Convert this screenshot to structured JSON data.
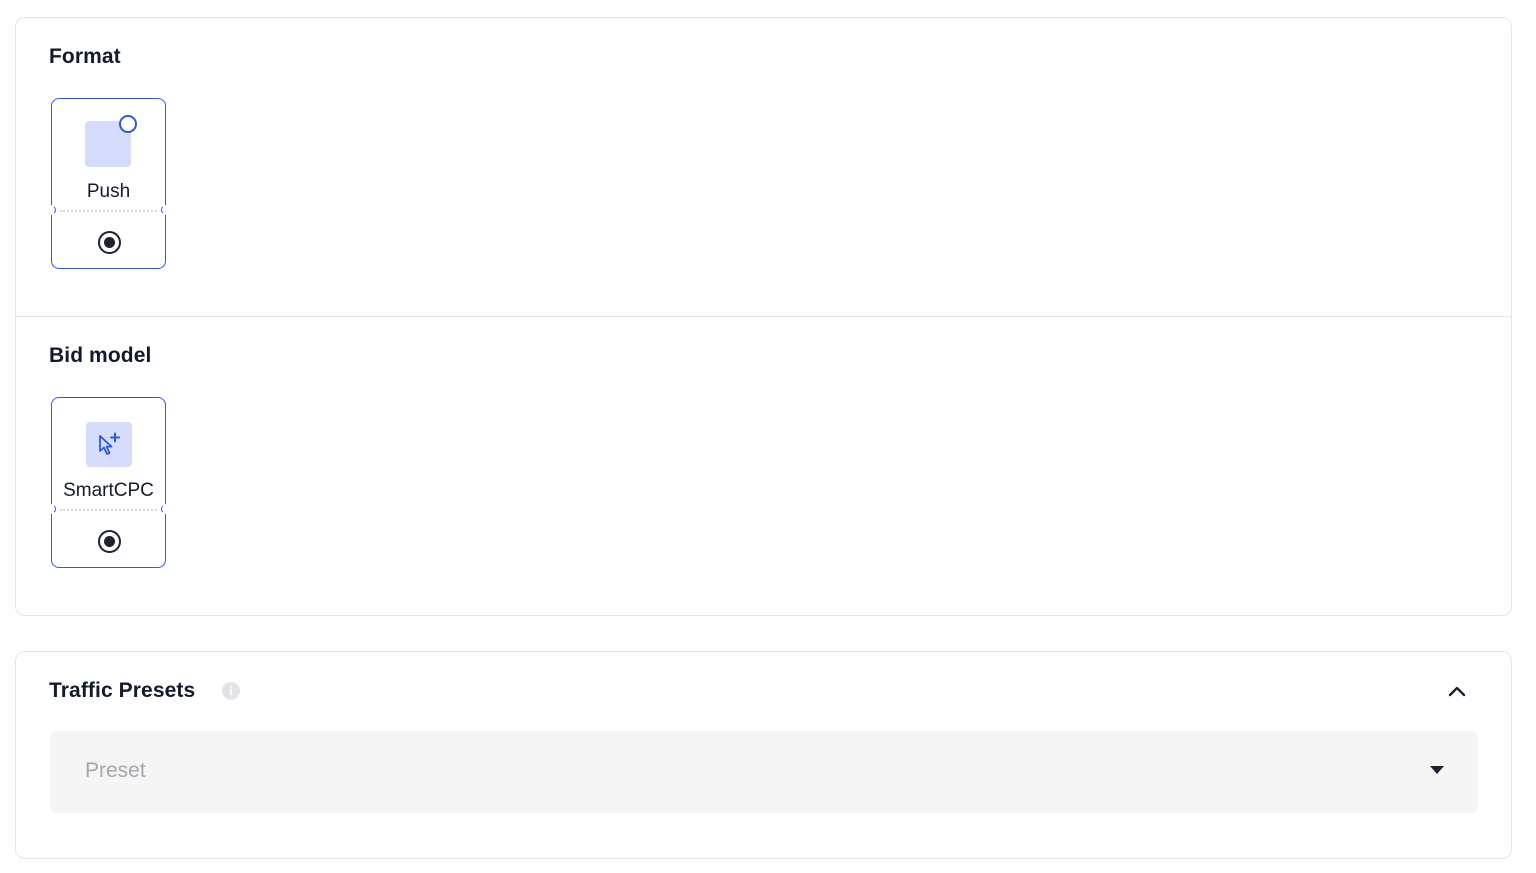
{
  "format_section": {
    "title": "Format",
    "options": [
      {
        "label": "Push",
        "selected": true,
        "icon": "push-square-icon"
      }
    ]
  },
  "bid_model_section": {
    "title": "Bid model",
    "options": [
      {
        "label": "SmartCPC",
        "selected": true,
        "icon": "cursor-plus-icon"
      }
    ]
  },
  "traffic_presets": {
    "title": "Traffic Presets",
    "info_icon": "info-icon",
    "expanded": true,
    "select": {
      "placeholder": "Preset",
      "value": ""
    }
  },
  "colors": {
    "accent": "#2f56e4",
    "tile_bg": "#d6ddfc",
    "text": "#141a2e",
    "placeholder": "#a3a6ad",
    "select_bg": "#f5f5f6",
    "border": "#e3e5ea"
  }
}
